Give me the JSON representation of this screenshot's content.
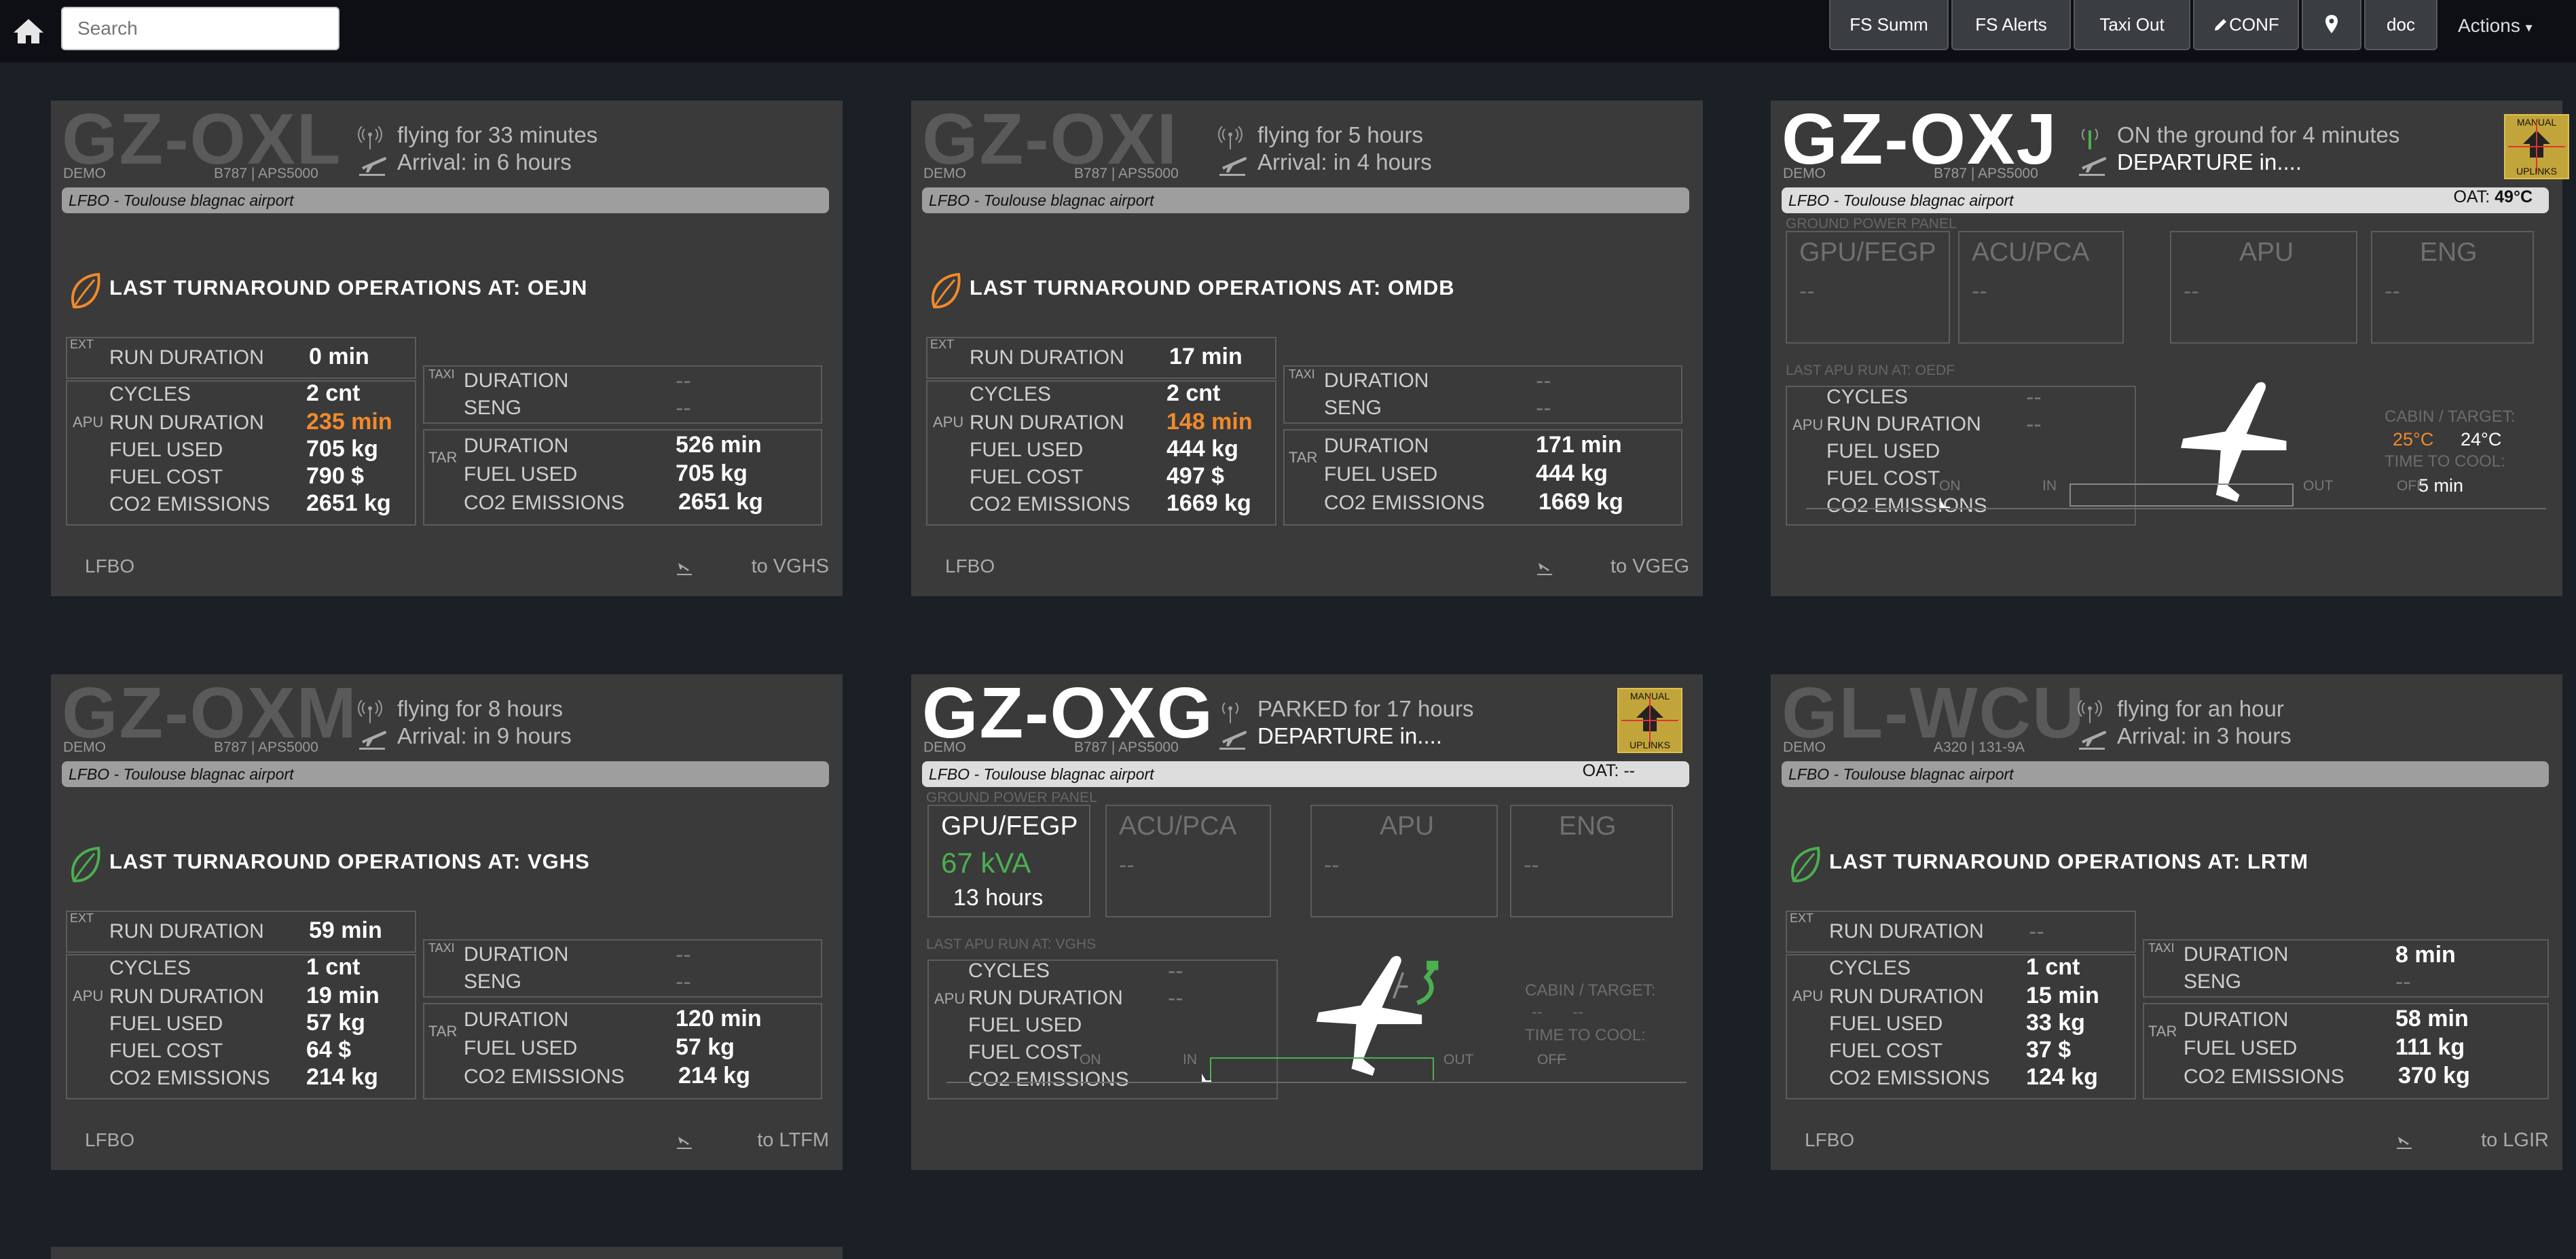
{
  "topbar": {
    "search_placeholder": "Search",
    "buttons": [
      "FS Summ",
      "FS Alerts",
      "Taxi Out",
      "CONF",
      "doc"
    ],
    "actions_label": "Actions"
  },
  "cards": [
    {
      "reg": "GZ-OXL",
      "demo": "DEMO",
      "model": "B787 | APS5000",
      "status1": "flying for 33 minutes",
      "status2": "Arrival: in 6 hours",
      "airport": "LFBO - Toulouse blagnac airport",
      "lto": "LAST TURNAROUND OPERATIONS AT: OEJN",
      "ext": {
        "label": "EXT",
        "run_duration_label": "RUN DURATION",
        "run_duration": "0 min"
      },
      "apu": {
        "label": "APU",
        "cycles_label": "CYCLES",
        "cycles": "2 cnt",
        "run_label": "RUN DURATION",
        "run": "235 min",
        "fuel_label": "FUEL USED",
        "fuel": "705 kg",
        "cost_label": "FUEL COST",
        "cost": "790 $",
        "co2_label": "CO2 EMISSIONS",
        "co2": "2651 kg"
      },
      "taxi": {
        "label": "TAXI",
        "duration_label": "DURATION",
        "duration": "--",
        "seng_label": "SENG",
        "seng": "--"
      },
      "tar": {
        "label": "TAR",
        "duration_label": "DURATION",
        "duration": "526 min",
        "fuel_label": "FUEL USED",
        "fuel": "705 kg",
        "co2_label": "CO2 EMISSIONS",
        "co2": "2651 kg"
      },
      "from": "LFBO",
      "to": "to VGHS"
    },
    {
      "reg": "GZ-OXI",
      "demo": "DEMO",
      "model": "B787 | APS5000",
      "status1": "flying for 5 hours",
      "status2": "Arrival: in 4 hours",
      "airport": "LFBO - Toulouse blagnac airport",
      "lto": "LAST TURNAROUND OPERATIONS AT: OMDB",
      "ext": {
        "label": "EXT",
        "run_duration_label": "RUN DURATION",
        "run_duration": "17 min"
      },
      "apu": {
        "label": "APU",
        "cycles_label": "CYCLES",
        "cycles": "2 cnt",
        "run_label": "RUN DURATION",
        "run": "148 min",
        "fuel_label": "FUEL USED",
        "fuel": "444 kg",
        "cost_label": "FUEL COST",
        "cost": "497 $",
        "co2_label": "CO2 EMISSIONS",
        "co2": "1669 kg"
      },
      "taxi": {
        "label": "TAXI",
        "duration_label": "DURATION",
        "duration": "--",
        "seng_label": "SENG",
        "seng": "--"
      },
      "tar": {
        "label": "TAR",
        "duration_label": "DURATION",
        "duration": "171 min",
        "fuel_label": "FUEL USED",
        "fuel": "444 kg",
        "co2_label": "CO2 EMISSIONS",
        "co2": "1669 kg"
      },
      "from": "LFBO",
      "to": "to VGEG"
    },
    {
      "reg": "GZ-OXJ",
      "demo": "DEMO",
      "model": "B787 | APS5000",
      "status1": "ON the ground for 4 minutes",
      "status2": "DEPARTURE in....",
      "airport": "LFBO - Toulouse blagnac airport",
      "oat_label": "OAT:",
      "oat": "49°C",
      "uplinks_top": "MANUAL",
      "uplinks_bottom": "UPLINKS",
      "gp_title": "GROUND POWER PANEL",
      "gp": [
        {
          "name": "GPU/FEGP",
          "val": "--"
        },
        {
          "name": "ACU/PCA",
          "val": "--"
        },
        {
          "name": "APU",
          "val": "--"
        },
        {
          "name": "ENG",
          "val": "--"
        }
      ],
      "apu_last": "LAST APU RUN AT: OEDF",
      "apu": {
        "label": "APU",
        "cycles_label": "CYCLES",
        "cycles": "--",
        "run_label": "RUN DURATION",
        "run": "--",
        "fuel_label": "FUEL USED",
        "cost_label": "FUEL COST",
        "co2_label": "CO2 EMISSIONS"
      },
      "cabin_label": "CABIN / TARGET:",
      "cabin": "25°C",
      "target": "24°C",
      "cool_label": "TIME TO COOL:",
      "cool": "5 min",
      "timeline": [
        "ON",
        "IN",
        "OUT",
        "OFF"
      ]
    },
    {
      "reg": "GZ-OXM",
      "demo": "DEMO",
      "model": "B787 | APS5000",
      "status1": "flying for 8 hours",
      "status2": "Arrival: in 9 hours",
      "airport": "LFBO - Toulouse blagnac airport",
      "lto": "LAST TURNAROUND OPERATIONS AT: VGHS",
      "ext": {
        "label": "EXT",
        "run_duration_label": "RUN DURATION",
        "run_duration": "59 min"
      },
      "apu": {
        "label": "APU",
        "cycles_label": "CYCLES",
        "cycles": "1 cnt",
        "run_label": "RUN DURATION",
        "run": "19 min",
        "fuel_label": "FUEL USED",
        "fuel": "57 kg",
        "cost_label": "FUEL COST",
        "cost": "64 $",
        "co2_label": "CO2 EMISSIONS",
        "co2": "214 kg"
      },
      "taxi": {
        "label": "TAXI",
        "duration_label": "DURATION",
        "duration": "--",
        "seng_label": "SENG",
        "seng": "--"
      },
      "tar": {
        "label": "TAR",
        "duration_label": "DURATION",
        "duration": "120 min",
        "fuel_label": "FUEL USED",
        "fuel": "57 kg",
        "co2_label": "CO2 EMISSIONS",
        "co2": "214 kg"
      },
      "from": "LFBO",
      "to": "to LTFM"
    },
    {
      "reg": "GZ-OXG",
      "demo": "DEMO",
      "model": "B787 | APS5000",
      "status1": "PARKED for 17 hours",
      "status2": "DEPARTURE in....",
      "airport": "LFBO - Toulouse blagnac airport",
      "oat_label": "OAT:",
      "oat": "--",
      "uplinks_top": "MANUAL",
      "uplinks_bottom": "UPLINKS",
      "gp_title": "GROUND POWER PANEL",
      "gp": [
        {
          "name": "GPU/FEGP",
          "val": "67 kVA",
          "sub": "13 hours"
        },
        {
          "name": "ACU/PCA",
          "val": "--"
        },
        {
          "name": "APU",
          "val": "--"
        },
        {
          "name": "ENG",
          "val": "--"
        }
      ],
      "apu_last": "LAST APU RUN AT: VGHS",
      "apu": {
        "label": "APU",
        "cycles_label": "CYCLES",
        "cycles": "--",
        "run_label": "RUN DURATION",
        "run": "--",
        "fuel_label": "FUEL USED",
        "cost_label": "FUEL COST",
        "co2_label": "CO2 EMISSIONS"
      },
      "cabin_label": "CABIN / TARGET:",
      "cabin": "--",
      "target": "--",
      "cool_label": "TIME TO COOL:",
      "cool": "--",
      "timeline": [
        "ON",
        "IN",
        "OUT",
        "OFF"
      ]
    },
    {
      "reg": "GL-WCU",
      "demo": "DEMO",
      "model": "A320 | 131-9A",
      "status1": "flying for an hour",
      "status2": "Arrival: in 3 hours",
      "airport": "LFBO - Toulouse blagnac airport",
      "lto": "LAST TURNAROUND OPERATIONS AT: LRTM",
      "ext": {
        "label": "EXT",
        "run_duration_label": "RUN DURATION",
        "run_duration": "--"
      },
      "apu": {
        "label": "APU",
        "cycles_label": "CYCLES",
        "cycles": "1 cnt",
        "run_label": "RUN DURATION",
        "run": "15 min",
        "fuel_label": "FUEL USED",
        "fuel": "33 kg",
        "cost_label": "FUEL COST",
        "cost": "37 $",
        "co2_label": "CO2 EMISSIONS",
        "co2": "124 kg"
      },
      "taxi": {
        "label": "TAXI",
        "duration_label": "DURATION",
        "duration": "8 min",
        "seng_label": "SENG",
        "seng": "--"
      },
      "tar": {
        "label": "TAR",
        "duration_label": "DURATION",
        "duration": "58 min",
        "fuel_label": "FUEL USED",
        "fuel": "111 kg",
        "co2_label": "CO2 EMISSIONS",
        "co2": "370 kg"
      },
      "from": "LFBO",
      "to": "to LGIR"
    }
  ],
  "colors": {
    "accent_orange": "#f08a2c",
    "green": "#4caf50",
    "card_bg": "#3a3a3a",
    "page_bg": "#1b1f26"
  }
}
